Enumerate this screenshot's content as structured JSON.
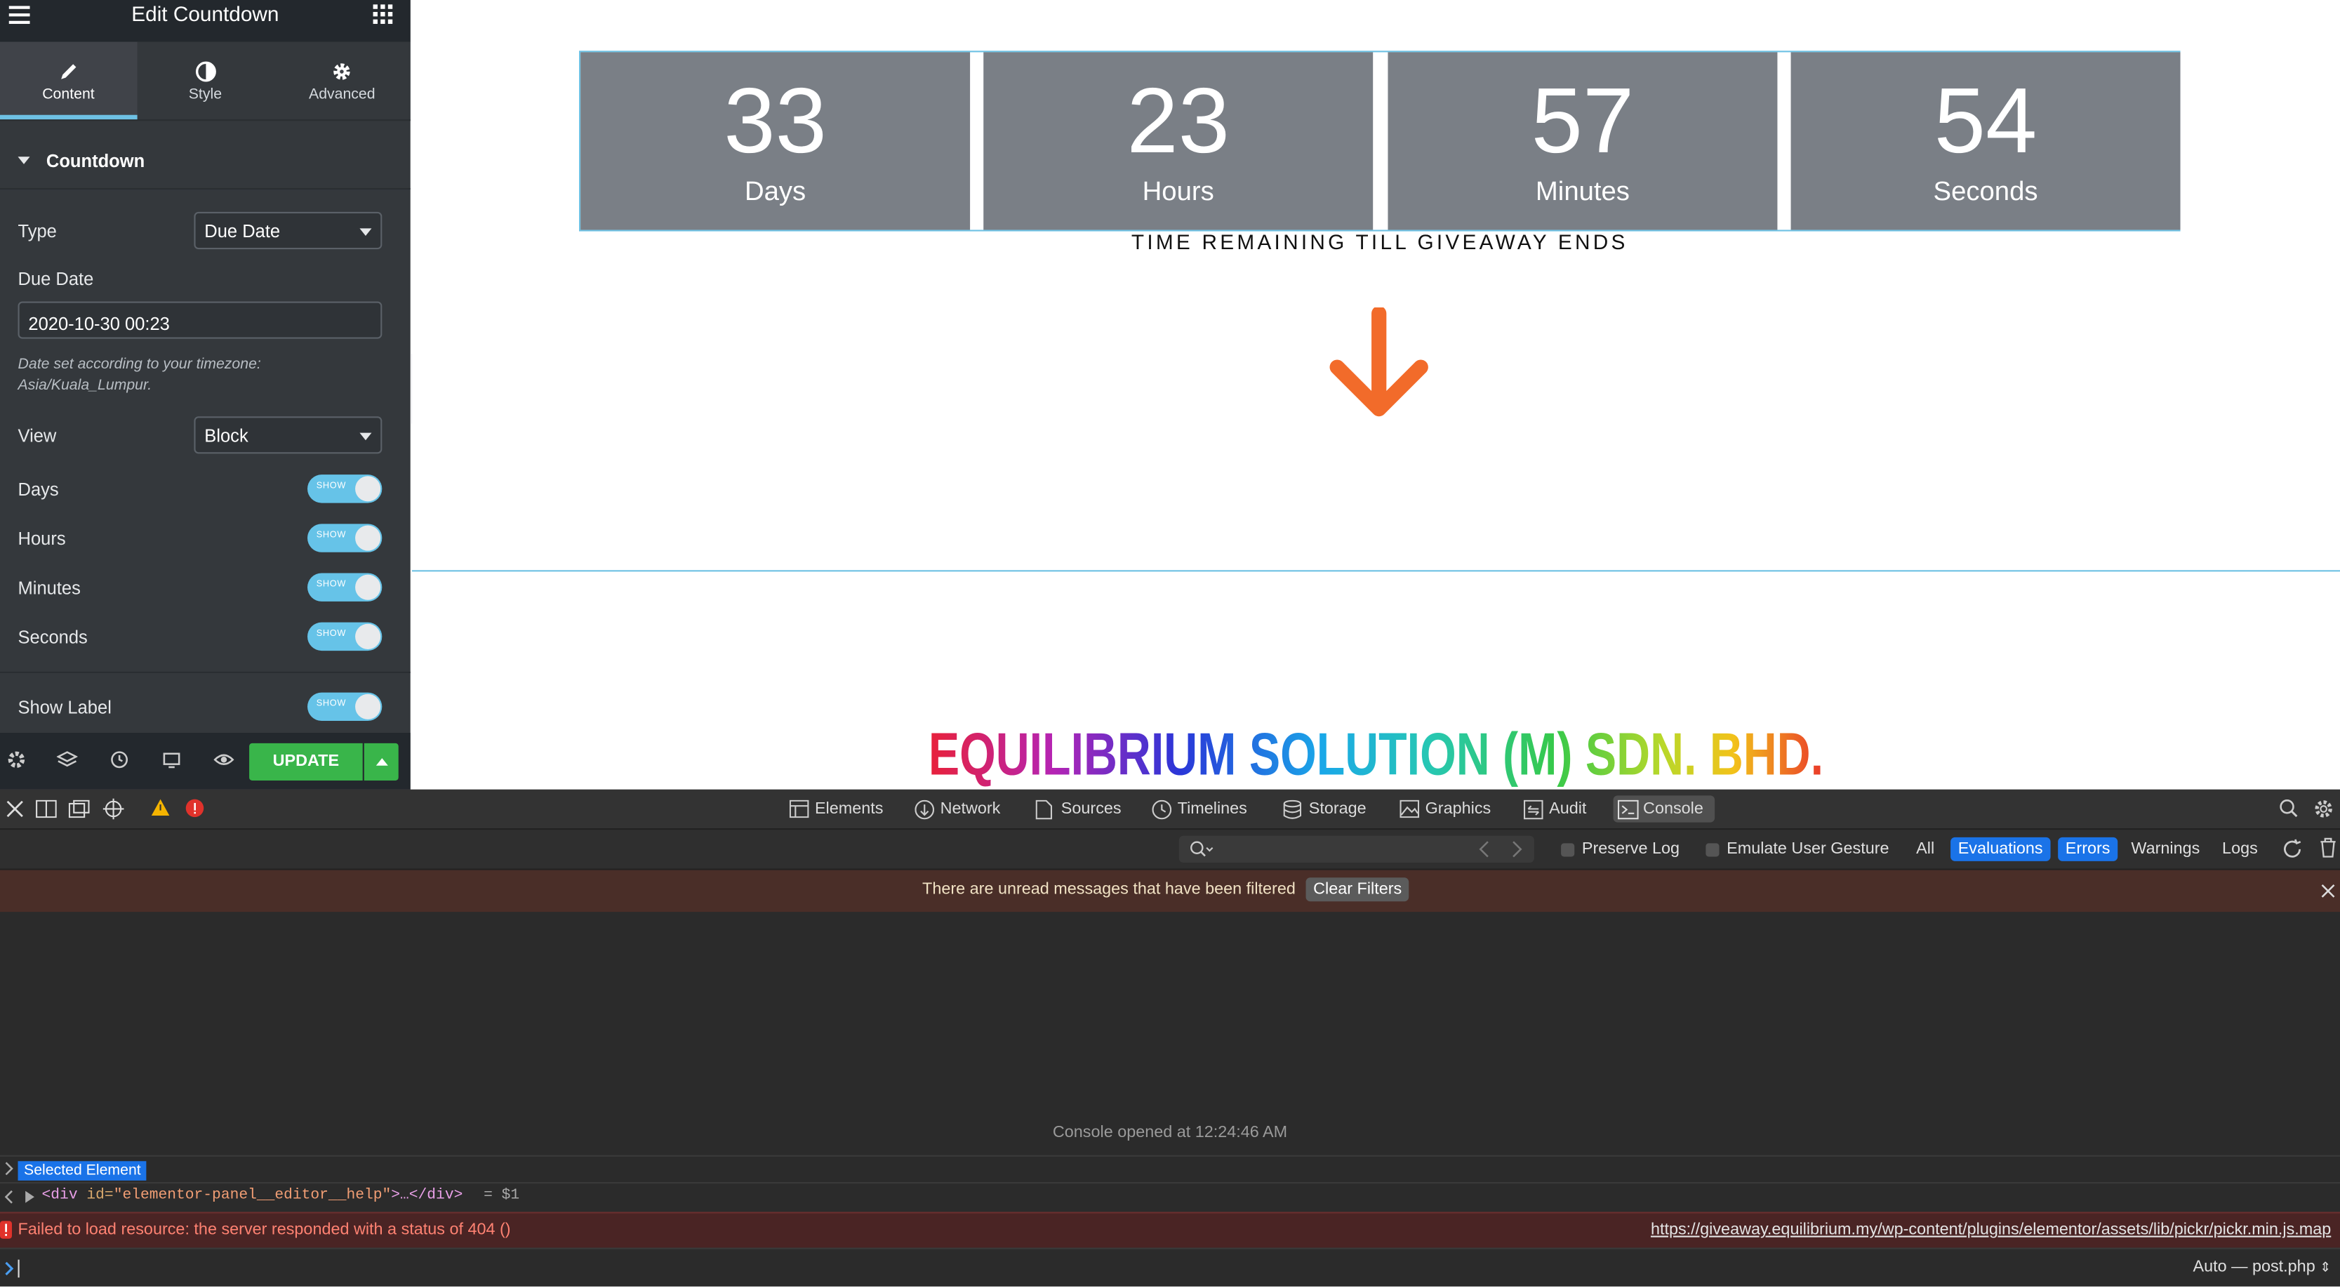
{
  "panel": {
    "title": "Edit Countdown",
    "tabs": [
      {
        "label": "Content",
        "icon": "pencil-icon",
        "active": true
      },
      {
        "label": "Style",
        "icon": "contrast-icon",
        "active": false
      },
      {
        "label": "Advanced",
        "icon": "gear-icon",
        "active": false
      }
    ],
    "section_title": "Countdown",
    "type_label": "Type",
    "type_value": "Due Date",
    "due_date_label": "Due Date",
    "due_date_value": "2020-10-30 00:23",
    "timezone_note": "Date set according to your timezone: Asia/Kuala_Lumpur.",
    "view_label": "View",
    "view_value": "Block",
    "toggles": [
      {
        "label": "Days",
        "state": "SHOW"
      },
      {
        "label": "Hours",
        "state": "SHOW"
      },
      {
        "label": "Minutes",
        "state": "SHOW"
      },
      {
        "label": "Seconds",
        "state": "SHOW"
      }
    ],
    "show_label": {
      "label": "Show Label",
      "state": "SHOW"
    },
    "update_label": "UPDATE",
    "accent_color": "#39b54a"
  },
  "canvas": {
    "countdown": [
      {
        "value": "33",
        "unit": "Days"
      },
      {
        "value": "23",
        "unit": "Hours"
      },
      {
        "value": "57",
        "unit": "Minutes"
      },
      {
        "value": "54",
        "unit": "Seconds"
      }
    ],
    "caption": "TIME REMAINING TILL GIVEAWAY ENDS",
    "arrow_color": "#f26b2a",
    "company_name": "EQUILIBRIUM SOLUTION (M) SDN. BHD."
  },
  "devtools": {
    "tabs": [
      "Elements",
      "Network",
      "Sources",
      "Timelines",
      "Storage",
      "Graphics",
      "Audit",
      "Console"
    ],
    "active_tab": "Console",
    "filters": {
      "preserve_log": "Preserve Log",
      "emulate_gesture": "Emulate User Gesture",
      "all": "All",
      "evaluations": "Evaluations",
      "errors": "Errors",
      "warnings": "Warnings",
      "logs": "Logs"
    },
    "warning_message": "There are unread messages that have been filtered",
    "clear_filters": "Clear Filters",
    "console_opened": "Console opened at 12:24:46 AM",
    "selected_element": "Selected Element",
    "element_line": {
      "open": "<div",
      "attr": "id=",
      "val": "\"elementor-panel__editor__help\"",
      "rest": ">…</div>",
      "ref": "= $1"
    },
    "error_message": "Failed to load resource: the server responded with a status of 404 ()",
    "error_url": "https://giveaway.equilibrium.my/wp-content/plugins/elementor/assets/lib/pickr/pickr.min.js.map",
    "context": "Auto — post.php"
  }
}
